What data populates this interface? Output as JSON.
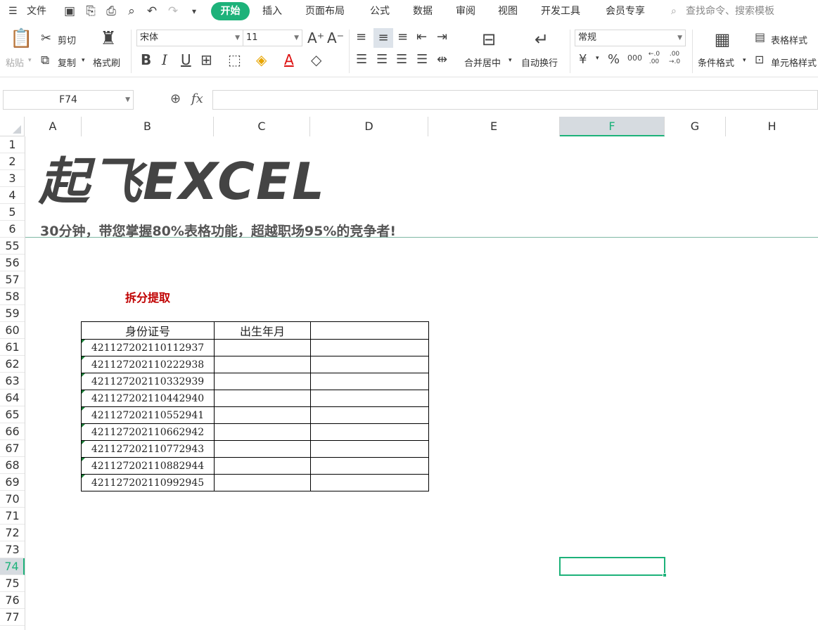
{
  "menubar": {
    "file_label": "文件",
    "tabs": [
      "开始",
      "插入",
      "页面布局",
      "公式",
      "数据",
      "审阅",
      "视图",
      "开发工具",
      "会员专享"
    ],
    "search_placeholder": "查找命令、搜索模板"
  },
  "ribbon": {
    "paste": "粘贴",
    "cut": "剪切",
    "copy": "复制",
    "format_painter": "格式刷",
    "font_name": "宋体",
    "font_size": "11",
    "merge_center": "合并居中",
    "wrap_text": "自动换行",
    "number_format": "常规",
    "conditional_format": "条件格式",
    "table_style": "表格样式",
    "cell_style": "单元格样式",
    "percent": "%",
    "thousands": "000",
    "inc_decimal": "←.0 .00",
    "dec_decimal": ".00 →.0",
    "currency": "¥"
  },
  "formula": {
    "cell_ref": "F74",
    "fx": "fx",
    "value": ""
  },
  "columns": [
    "A",
    "B",
    "C",
    "D",
    "E",
    "F",
    "G",
    "H"
  ],
  "rows": [
    "1",
    "2",
    "3",
    "4",
    "5",
    "6",
    "55",
    "56",
    "57",
    "58",
    "59",
    "60",
    "61",
    "62",
    "63",
    "64",
    "65",
    "66",
    "67",
    "68",
    "69",
    "70",
    "71",
    "72",
    "73",
    "74",
    "75",
    "76",
    "77"
  ],
  "banner": {
    "logo": "起飞EXCEL",
    "tagline": "30分钟，带您掌握80%表格功能，超越职场95%的竞争者!"
  },
  "content": {
    "section_title": "拆分提取",
    "table_headers": [
      "身份证号",
      "出生年月",
      ""
    ],
    "ids": [
      "421127202110112937",
      "421127202110222938",
      "421127202110332939",
      "421127202110442940",
      "421127202110552941",
      "421127202110662942",
      "421127202110772943",
      "421127202110882944",
      "421127202110992945"
    ]
  },
  "colors": {
    "accent": "#1db27a",
    "title_red": "#c00000"
  }
}
